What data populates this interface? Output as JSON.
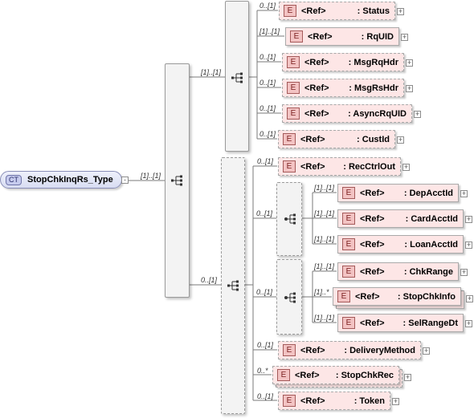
{
  "root": {
    "badge": "CT",
    "name": "StopChkInqRs_Type",
    "expand": "-"
  },
  "root_mult": "[1]..[1]",
  "upper_seq_mult": "[1]..[1]",
  "lower_seq_mult": "0..[1]",
  "choice_1_mult": "0..[1]",
  "choice_2_mult": "0..[1]",
  "element_badge": "E",
  "ref_label": "<Ref>",
  "expand_symbol": "+",
  "elements": [
    {
      "key": "status",
      "name": ": Status",
      "mult": "0..[1]",
      "optional": true
    },
    {
      "key": "rquid",
      "name": ": RqUID",
      "mult": "[1]..[1]",
      "optional": false
    },
    {
      "key": "msgrqhdr",
      "name": ": MsgRqHdr",
      "mult": "0..[1]",
      "optional": true
    },
    {
      "key": "msgrshdr",
      "name": ": MsgRsHdr",
      "mult": "0..[1]",
      "optional": true
    },
    {
      "key": "asyncrquid",
      "name": ": AsyncRqUID",
      "mult": "0..[1]",
      "optional": true
    },
    {
      "key": "custid",
      "name": ": CustId",
      "mult": "0..[1]",
      "optional": true
    },
    {
      "key": "recctrlout",
      "name": ": RecCtrlOut",
      "mult": "0..[1]",
      "optional": true
    },
    {
      "key": "depacctid",
      "name": ": DepAcctId",
      "mult": "[1]..[1]",
      "optional": false
    },
    {
      "key": "cardacctid",
      "name": ": CardAcctId",
      "mult": "[1]..[1]",
      "optional": false
    },
    {
      "key": "loanacctid",
      "name": ": LoanAcctId",
      "mult": "[1]..[1]",
      "optional": false
    },
    {
      "key": "chkrange",
      "name": ": ChkRange",
      "mult": "[1]..[1]",
      "optional": false
    },
    {
      "key": "stopchkinfo",
      "name": ": StopChkInfo",
      "mult": "[1]..*",
      "optional": false
    },
    {
      "key": "selrangedt",
      "name": ": SelRangeDt",
      "mult": "[1]..[1]",
      "optional": false
    },
    {
      "key": "deliverymethod",
      "name": ": DeliveryMethod",
      "mult": "0..[1]",
      "optional": true
    },
    {
      "key": "stopchkrec",
      "name": ": StopChkRec",
      "mult": "0..*",
      "optional": true
    },
    {
      "key": "token",
      "name": ": Token",
      "mult": "0..[1]",
      "optional": true
    }
  ]
}
